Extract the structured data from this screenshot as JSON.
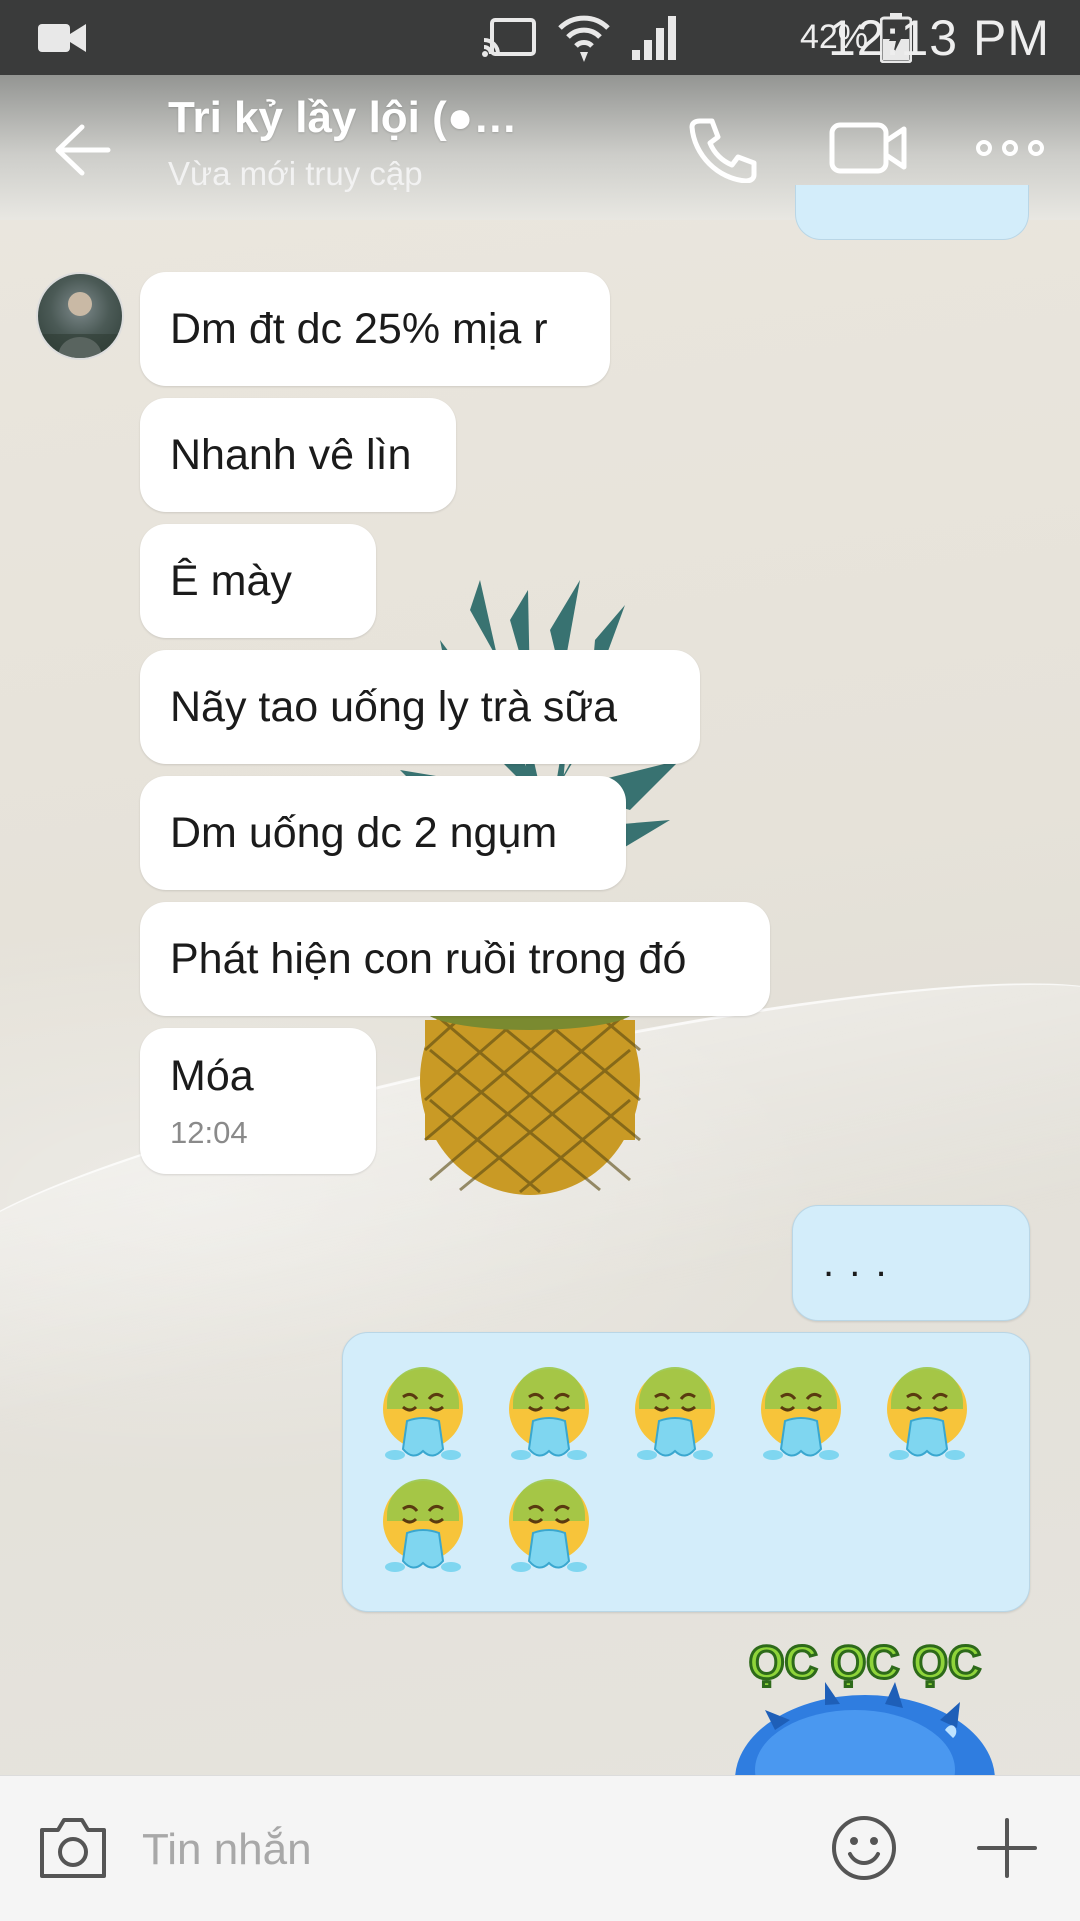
{
  "status_bar": {
    "battery_percent": "42%",
    "time": "12:13 PM"
  },
  "header": {
    "contact_name": "Tri kỷ lầy lội (●…",
    "status": "Vừa mới truy cập"
  },
  "messages": [
    {
      "text": "Dm đt dc 25% mịa r"
    },
    {
      "text": "Nhanh vê lìn"
    },
    {
      "text": "Ê mày"
    },
    {
      "text": "Nãy tao uống ly trà sữa"
    },
    {
      "text": "Dm uống dc 2 ngụm"
    },
    {
      "text": "Phát hiện con ruồi trong đó"
    },
    {
      "text": "Móa",
      "time": "12:04"
    }
  ],
  "outgoing": {
    "dots": ". . .",
    "emoji_count": 7,
    "emoji_name": "vomiting-face-sticker"
  },
  "sticker": {
    "caption": "ỌC ỌC ỌC"
  },
  "composer": {
    "placeholder": "Tin nhắn"
  },
  "colors": {
    "outgoing_bubble": "#d3edfa",
    "incoming_bubble": "#ffffff",
    "status_bar": "#3a3b3b"
  }
}
